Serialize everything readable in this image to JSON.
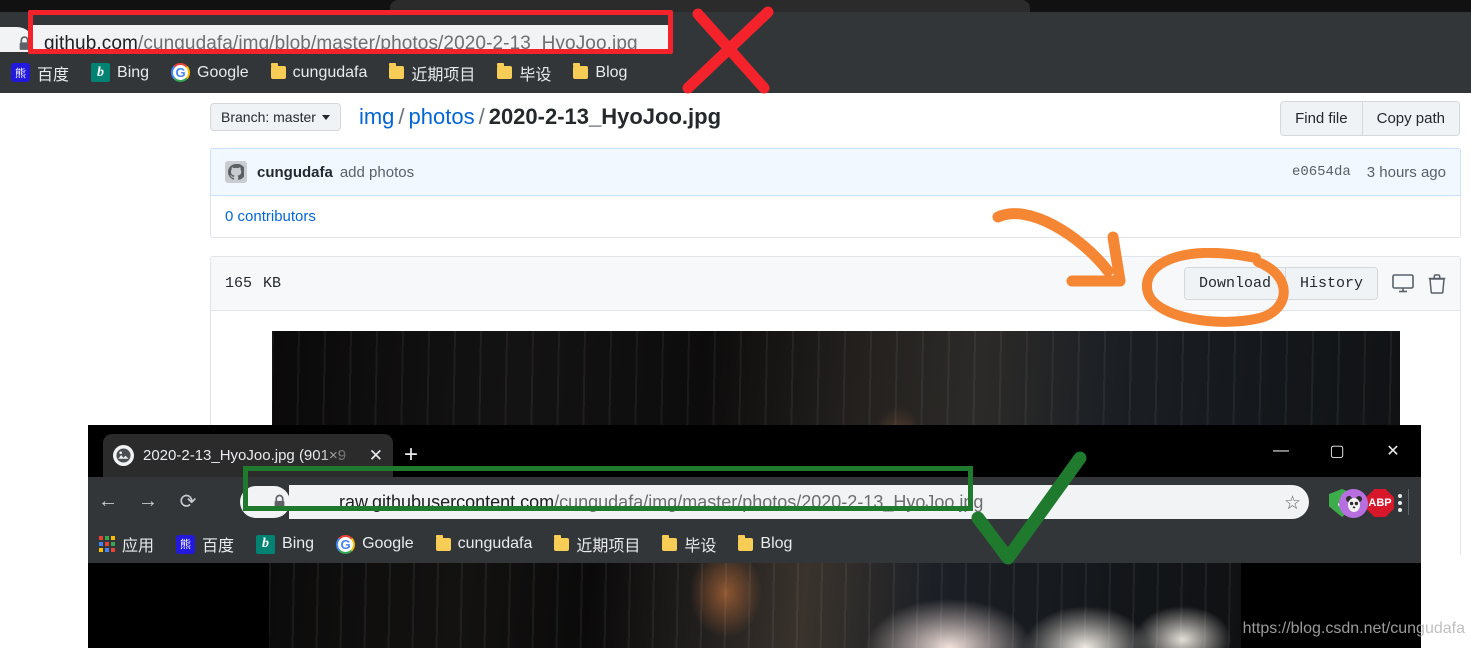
{
  "window_github": {
    "omnibox": {
      "url_host": "github.com",
      "url_path": "/cungudafa/img/blob/master/photos/2020-2-13_HyoJoo.jpg",
      "lock_icon": "lock-icon"
    },
    "bookmarks": [
      {
        "label": "百度",
        "icon": "baidu-icon"
      },
      {
        "label": "Bing",
        "icon": "bing-icon"
      },
      {
        "label": "Google",
        "icon": "google-icon"
      },
      {
        "label": "cungudafa",
        "icon": "folder-icon"
      },
      {
        "label": "近期项目",
        "icon": "folder-icon"
      },
      {
        "label": "毕设",
        "icon": "folder-icon"
      },
      {
        "label": "Blog",
        "icon": "folder-icon"
      }
    ],
    "page": {
      "branch_button": "Branch: master",
      "breadcrumb": {
        "dir1": "img",
        "dir2": "photos",
        "file": "2020-2-13_HyoJoo.jpg",
        "separator": "/"
      },
      "header_actions": {
        "find_file": "Find file",
        "copy_path": "Copy path"
      },
      "commit": {
        "author": "cungudafa",
        "message": "add photos",
        "sha": "e0654da",
        "time": "3 hours ago"
      },
      "contributors": "0 contributors",
      "file_meta": {
        "size": "165",
        "unit": "KB"
      },
      "file_actions": {
        "download": "Download",
        "history": "History",
        "display_icon": "monitor-icon",
        "delete_icon": "trash-icon"
      }
    }
  },
  "window_chrome": {
    "tab": {
      "title": "2020-2-13_HyoJoo.jpg (901×9",
      "close": "✕",
      "favicon": "image-file-icon"
    },
    "new_tab": "+",
    "window_controls": {
      "minimize": "—",
      "maximize": "▢",
      "close": "✕"
    },
    "nav": {
      "back": "←",
      "forward": "→",
      "reload": "⟳"
    },
    "omnibox": {
      "url_host": "raw.githubusercontent.com",
      "url_path": "/cungudafa/img/master/photos/2020-2-13_HyoJoo.jpg",
      "lock_icon": "lock-icon",
      "star_icon": "star-icon"
    },
    "extensions": [
      {
        "name": "shield-icon",
        "label": "✓"
      },
      {
        "name": "adblock-plus-icon",
        "label": "ABP"
      }
    ],
    "profile": {
      "name": "profile-avatar",
      "label": "🐼"
    },
    "menu_icon": "three-dot-menu-icon",
    "bookmarks": [
      {
        "label": "应用",
        "icon": "apps-grid-icon"
      },
      {
        "label": "百度",
        "icon": "baidu-icon"
      },
      {
        "label": "Bing",
        "icon": "bing-icon"
      },
      {
        "label": "Google",
        "icon": "google-icon"
      },
      {
        "label": "cungudafa",
        "icon": "folder-icon"
      },
      {
        "label": "近期项目",
        "icon": "folder-icon"
      },
      {
        "label": "毕设",
        "icon": "folder-icon"
      },
      {
        "label": "Blog",
        "icon": "folder-icon"
      }
    ]
  },
  "annotations": {
    "red_box_color": "#f4232b",
    "red_x_color": "#f4232b",
    "orange_color": "#f58634",
    "green_color": "#1f7a2e",
    "red_x_icon": "red-x-mark",
    "green_check_icon": "green-check-mark",
    "orange_arrow_icon": "orange-arrow",
    "orange_circle_icon": "orange-circle-highlight"
  },
  "watermark": "https://blog.csdn.net/cungudafa"
}
